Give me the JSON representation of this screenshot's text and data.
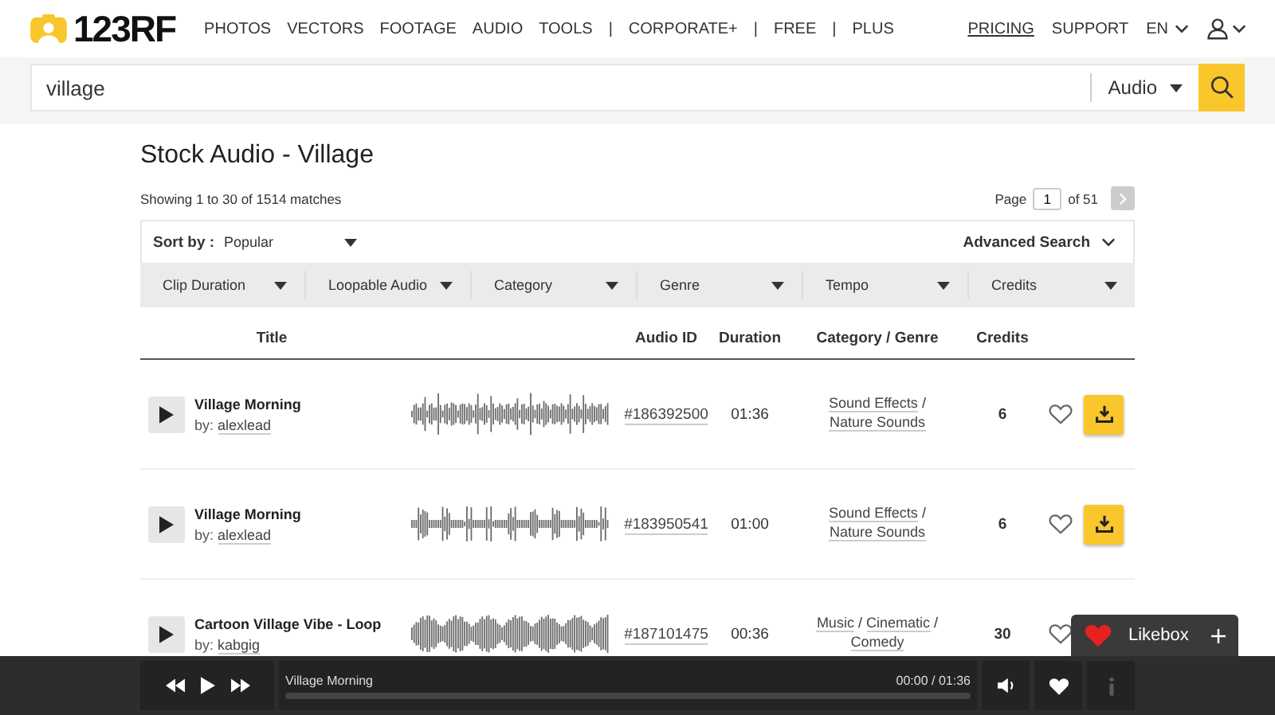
{
  "header": {
    "logo": "123RF",
    "nav_separator": "|",
    "nav_groups": [
      [
        "PHOTOS",
        "VECTORS",
        "FOOTAGE",
        "AUDIO",
        "TOOLS"
      ],
      [
        "CORPORATE+"
      ],
      [
        "FREE"
      ],
      [
        "PLUS"
      ]
    ],
    "right": [
      {
        "label": "PRICING",
        "selected": true
      },
      {
        "label": "SUPPORT",
        "selected": false
      }
    ],
    "language": "EN"
  },
  "search": {
    "value": "village",
    "type": "Audio"
  },
  "title": "Stock Audio - Village",
  "showing": "Showing 1 to 30 of 1514 matches",
  "pagination": {
    "label": "Page",
    "page": "1",
    "total": "of 51",
    "next_disabled": true
  },
  "sort": {
    "label": "Sort by :",
    "value": "Popular",
    "advanced": "Advanced Search"
  },
  "filters": [
    "Clip Duration",
    "Loopable Audio",
    "Category",
    "Genre",
    "Tempo",
    "Credits"
  ],
  "table": {
    "columns": [
      "Title",
      "Audio ID",
      "Duration",
      "Category / Genre",
      "Credits"
    ],
    "category_separator": "/",
    "rows": [
      {
        "title": "Village Morning",
        "by": "by:",
        "author": "alexlead",
        "audio_id": "#186392500",
        "duration": "01:36",
        "categories": [
          "Sound Effects",
          "Nature Sounds"
        ],
        "credits": "6",
        "liked": false
      },
      {
        "title": "Village Morning",
        "by": "by:",
        "author": "alexlead",
        "audio_id": "#183950541",
        "duration": "01:00",
        "categories": [
          "Sound Effects",
          "Nature Sounds"
        ],
        "credits": "6",
        "liked": false
      },
      {
        "title": "Cartoon Village Vibe - Loop",
        "by": "by:",
        "author": "kabgig",
        "audio_id": "#187101475",
        "duration": "00:36",
        "categories": [
          "Music",
          "Cinematic",
          "Comedy"
        ],
        "credits": "30",
        "liked": false
      }
    ]
  },
  "likebox": {
    "label": "Likebox"
  },
  "player": {
    "track": "Village Morning",
    "time": "00:00 / 01:36",
    "level": 0,
    "info_disabled": true
  }
}
